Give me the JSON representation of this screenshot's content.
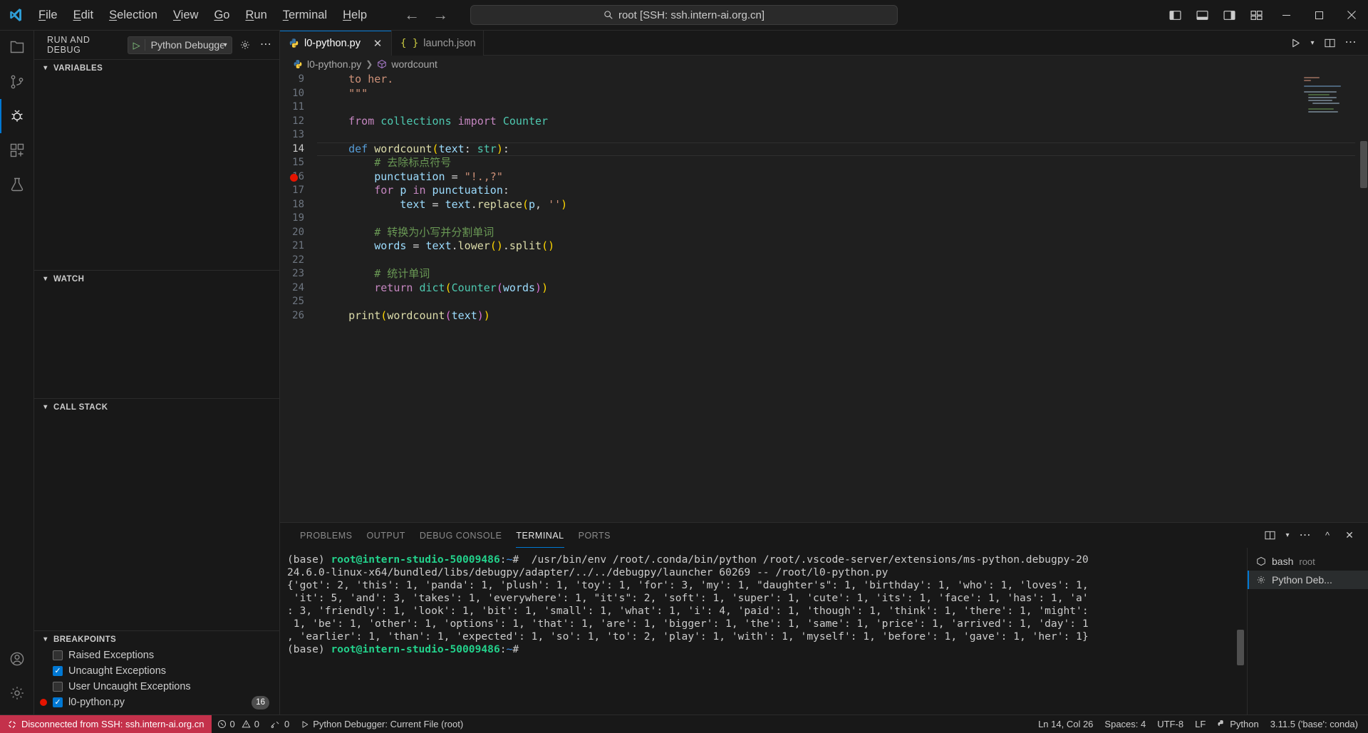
{
  "titlebar": {
    "logo_icon": "vscode-logo",
    "menu": [
      {
        "label": "File",
        "mnemonic": "F"
      },
      {
        "label": "Edit",
        "mnemonic": "E"
      },
      {
        "label": "Selection",
        "mnemonic": "S"
      },
      {
        "label": "View",
        "mnemonic": "V"
      },
      {
        "label": "Go",
        "mnemonic": "G"
      },
      {
        "label": "Run",
        "mnemonic": "R"
      },
      {
        "label": "Terminal",
        "mnemonic": "T"
      },
      {
        "label": "Help",
        "mnemonic": "H"
      }
    ],
    "back_icon": "arrow-left-icon",
    "forward_icon": "arrow-right-icon",
    "command_center": {
      "text": "root [SSH: ssh.intern-ai.org.cn]",
      "icon": "search-icon"
    },
    "layout_icons": [
      "toggle-primary-sidebar-icon",
      "toggle-panel-icon",
      "toggle-secondary-sidebar-icon",
      "customize-layout-icon"
    ],
    "window_controls": {
      "minimize": "─",
      "maximize": "☐",
      "close": "✕"
    }
  },
  "activitybar": {
    "items": [
      {
        "name": "explorer",
        "icon": "files-icon",
        "active": false
      },
      {
        "name": "source-control",
        "icon": "source-control-icon",
        "active": false
      },
      {
        "name": "run-and-debug",
        "icon": "debug-icon",
        "active": true
      },
      {
        "name": "extensions",
        "icon": "extensions-icon",
        "active": false
      },
      {
        "name": "testing",
        "icon": "beaker-icon",
        "active": false
      }
    ],
    "bottom": [
      {
        "name": "accounts",
        "icon": "account-icon"
      },
      {
        "name": "settings",
        "icon": "gear-icon"
      }
    ]
  },
  "sidebar": {
    "title": "RUN AND DEBUG",
    "debug_config": {
      "label": "Python Debugger: ",
      "play_icon": "play-icon",
      "chevron": "⌄"
    },
    "gear_icon": "gear-icon",
    "more_icon": "ellipsis-icon",
    "sections": [
      {
        "name": "variables",
        "title": "VARIABLES",
        "expanded": true
      },
      {
        "name": "watch",
        "title": "WATCH",
        "expanded": true
      },
      {
        "name": "call-stack",
        "title": "CALL STACK",
        "expanded": true
      },
      {
        "name": "breakpoints",
        "title": "BREAKPOINTS",
        "expanded": true
      }
    ],
    "breakpoints": [
      {
        "label": "Raised Exceptions",
        "checked": false,
        "dot": false,
        "badge": null
      },
      {
        "label": "Uncaught Exceptions",
        "checked": true,
        "dot": false,
        "badge": null
      },
      {
        "label": "User Uncaught Exceptions",
        "checked": false,
        "dot": false,
        "badge": null
      },
      {
        "label": "l0-python.py",
        "checked": true,
        "dot": true,
        "badge": "16"
      }
    ]
  },
  "editor": {
    "tabs": [
      {
        "label": "l0-python.py",
        "icon": "python-icon",
        "active": true,
        "close": "✕"
      },
      {
        "label": "launch.json",
        "icon": "json-braces-icon",
        "active": false,
        "close": ""
      }
    ],
    "actions": [
      "run-python-file-icon",
      "chevron-down-icon",
      "split-editor-icon",
      "more-actions-icon"
    ],
    "breadcrumb": {
      "file": "l0-python.py",
      "file_icon": "python-icon",
      "separator": "›",
      "symbol": "wordcount",
      "symbol_icon": "symbol-method-icon"
    },
    "first_line_number": 9,
    "current_line": 14,
    "breakpoint_line": 16,
    "lines": [
      {
        "n": 9,
        "tokens": [
          {
            "t": "    ",
            "c": "pl"
          },
          {
            "t": "to her.",
            "c": "str"
          }
        ]
      },
      {
        "n": 10,
        "tokens": [
          {
            "t": "    ",
            "c": "pl"
          },
          {
            "t": "\"\"\"",
            "c": "str"
          }
        ]
      },
      {
        "n": 11,
        "tokens": []
      },
      {
        "n": 12,
        "tokens": [
          {
            "t": "    ",
            "c": "pl"
          },
          {
            "t": "from",
            "c": "k"
          },
          {
            "t": " ",
            "c": "pl"
          },
          {
            "t": "collections",
            "c": "ty"
          },
          {
            "t": " ",
            "c": "pl"
          },
          {
            "t": "import",
            "c": "k"
          },
          {
            "t": " ",
            "c": "pl"
          },
          {
            "t": "Counter",
            "c": "ty"
          }
        ]
      },
      {
        "n": 13,
        "tokens": []
      },
      {
        "n": 14,
        "tokens": [
          {
            "t": "    ",
            "c": "pl"
          },
          {
            "t": "def",
            "c": "kw"
          },
          {
            "t": " ",
            "c": "pl"
          },
          {
            "t": "wordcount",
            "c": "fn"
          },
          {
            "t": "(",
            "c": "pun"
          },
          {
            "t": "text",
            "c": "var"
          },
          {
            "t": ": ",
            "c": "pl"
          },
          {
            "t": "str",
            "c": "ty"
          },
          {
            "t": ")",
            "c": "pun"
          },
          {
            "t": ":",
            "c": "pl"
          }
        ]
      },
      {
        "n": 15,
        "tokens": [
          {
            "t": "        ",
            "c": "pl"
          },
          {
            "t": "# 去除标点符号",
            "c": "cmt"
          }
        ]
      },
      {
        "n": 16,
        "tokens": [
          {
            "t": "        ",
            "c": "pl"
          },
          {
            "t": "punctuation",
            "c": "var"
          },
          {
            "t": " ",
            "c": "pl"
          },
          {
            "t": "=",
            "c": "pl"
          },
          {
            "t": " ",
            "c": "pl"
          },
          {
            "t": "\"!.,?\"",
            "c": "str"
          }
        ]
      },
      {
        "n": 17,
        "tokens": [
          {
            "t": "        ",
            "c": "pl"
          },
          {
            "t": "for",
            "c": "k"
          },
          {
            "t": " ",
            "c": "pl"
          },
          {
            "t": "p",
            "c": "var"
          },
          {
            "t": " ",
            "c": "pl"
          },
          {
            "t": "in",
            "c": "k"
          },
          {
            "t": " ",
            "c": "pl"
          },
          {
            "t": "punctuation",
            "c": "var"
          },
          {
            "t": ":",
            "c": "pl"
          }
        ]
      },
      {
        "n": 18,
        "tokens": [
          {
            "t": "            ",
            "c": "pl"
          },
          {
            "t": "text",
            "c": "var"
          },
          {
            "t": " = ",
            "c": "pl"
          },
          {
            "t": "text",
            "c": "var"
          },
          {
            "t": ".",
            "c": "pl"
          },
          {
            "t": "replace",
            "c": "fn"
          },
          {
            "t": "(",
            "c": "pun"
          },
          {
            "t": "p",
            "c": "var"
          },
          {
            "t": ", ",
            "c": "pl"
          },
          {
            "t": "''",
            "c": "str"
          },
          {
            "t": ")",
            "c": "pun"
          }
        ]
      },
      {
        "n": 19,
        "tokens": []
      },
      {
        "n": 20,
        "tokens": [
          {
            "t": "        ",
            "c": "pl"
          },
          {
            "t": "# 转换为小写并分割单词",
            "c": "cmt"
          }
        ]
      },
      {
        "n": 21,
        "tokens": [
          {
            "t": "        ",
            "c": "pl"
          },
          {
            "t": "words",
            "c": "var"
          },
          {
            "t": " = ",
            "c": "pl"
          },
          {
            "t": "text",
            "c": "var"
          },
          {
            "t": ".",
            "c": "pl"
          },
          {
            "t": "lower",
            "c": "fn"
          },
          {
            "t": "()",
            "c": "pun"
          },
          {
            "t": ".",
            "c": "pl"
          },
          {
            "t": "split",
            "c": "fn"
          },
          {
            "t": "()",
            "c": "pun"
          }
        ]
      },
      {
        "n": 22,
        "tokens": []
      },
      {
        "n": 23,
        "tokens": [
          {
            "t": "        ",
            "c": "pl"
          },
          {
            "t": "# 统计单词",
            "c": "cmt"
          }
        ]
      },
      {
        "n": 24,
        "tokens": [
          {
            "t": "        ",
            "c": "pl"
          },
          {
            "t": "return",
            "c": "k"
          },
          {
            "t": " ",
            "c": "pl"
          },
          {
            "t": "dict",
            "c": "ty"
          },
          {
            "t": "(",
            "c": "pun"
          },
          {
            "t": "Counter",
            "c": "ty"
          },
          {
            "t": "(",
            "c": "pun2"
          },
          {
            "t": "words",
            "c": "var"
          },
          {
            "t": ")",
            "c": "pun2"
          },
          {
            "t": ")",
            "c": "pun"
          }
        ]
      },
      {
        "n": 25,
        "tokens": []
      },
      {
        "n": 26,
        "tokens": [
          {
            "t": "    ",
            "c": "pl"
          },
          {
            "t": "print",
            "c": "fn"
          },
          {
            "t": "(",
            "c": "pun"
          },
          {
            "t": "wordcount",
            "c": "fn"
          },
          {
            "t": "(",
            "c": "pun2"
          },
          {
            "t": "text",
            "c": "var"
          },
          {
            "t": ")",
            "c": "pun2"
          },
          {
            "t": ")",
            "c": "pun"
          }
        ]
      }
    ]
  },
  "panel": {
    "tabs": [
      {
        "label": "PROBLEMS",
        "active": false
      },
      {
        "label": "OUTPUT",
        "active": false
      },
      {
        "label": "DEBUG CONSOLE",
        "active": false
      },
      {
        "label": "TERMINAL",
        "active": true
      },
      {
        "label": "PORTS",
        "active": false
      }
    ],
    "actions": [
      "split-terminal-icon",
      "chevron-down-icon",
      "more-actions-icon",
      "maximize-panel-icon",
      "close-panel-icon"
    ],
    "terminal_lines": [
      {
        "segments": [
          {
            "t": "(base) ",
            "c": "plain"
          },
          {
            "t": "root@intern-studio-50009486",
            "c": "green"
          },
          {
            "t": ":",
            "c": "plain"
          },
          {
            "t": "~",
            "c": "blue"
          },
          {
            "t": "#  /usr/bin/env /root/.conda/bin/python /root/.vscode-server/extensions/ms-python.debugpy-20",
            "c": "plain"
          }
        ]
      },
      {
        "segments": [
          {
            "t": "24.6.0-linux-x64/bundled/libs/debugpy/adapter/../../debugpy/launcher 60269 -- /root/l0-python.py",
            "c": "plain"
          }
        ]
      },
      {
        "segments": [
          {
            "t": "{'got': 2, 'this': 1, 'panda': 1, 'plush': 1, 'toy': 1, 'for': 3, 'my': 1, \"daughter's\": 1, 'birthday': 1, 'who': 1, 'loves': 1,",
            "c": "plain"
          }
        ]
      },
      {
        "segments": [
          {
            "t": " 'it': 5, 'and': 3, 'takes': 1, 'everywhere': 1, \"it's\": 2, 'soft': 1, 'super': 1, 'cute': 1, 'its': 1, 'face': 1, 'has': 1, 'a'",
            "c": "plain"
          }
        ]
      },
      {
        "segments": [
          {
            "t": ": 3, 'friendly': 1, 'look': 1, 'bit': 1, 'small': 1, 'what': 1, 'i': 4, 'paid': 1, 'though': 1, 'think': 1, 'there': 1, 'might':",
            "c": "plain"
          }
        ]
      },
      {
        "segments": [
          {
            "t": " 1, 'be': 1, 'other': 1, 'options': 1, 'that': 1, 'are': 1, 'bigger': 1, 'the': 1, 'same': 1, 'price': 1, 'arrived': 1, 'day': 1",
            "c": "plain"
          }
        ]
      },
      {
        "segments": [
          {
            "t": ", 'earlier': 1, 'than': 1, 'expected': 1, 'so': 1, 'to': 2, 'play': 1, 'with': 1, 'myself': 1, 'before': 1, 'gave': 1, 'her': 1}",
            "c": "plain"
          }
        ]
      },
      {
        "segments": [
          {
            "t": "(base) ",
            "c": "plain"
          },
          {
            "t": "root@intern-studio-50009486",
            "c": "green"
          },
          {
            "t": ":",
            "c": "plain"
          },
          {
            "t": "~",
            "c": "blue"
          },
          {
            "t": "#",
            "c": "plain"
          }
        ]
      }
    ],
    "terminal_list": [
      {
        "label": "bash",
        "sub": "root",
        "icon": "terminal-bash-icon",
        "active": false
      },
      {
        "label": "Python Deb...",
        "sub": "",
        "icon": "debug-gear-icon",
        "active": true
      }
    ]
  },
  "statusbar": {
    "remote": {
      "icon": "remote-disconnect-icon",
      "label": "Disconnected from SSH: ssh.intern-ai.org.cn"
    },
    "left": [
      {
        "name": "problems",
        "icon": "error-warning-icon",
        "label": "0  0",
        "errors": "0",
        "warnings": "0"
      },
      {
        "name": "ports",
        "icon": "ports-icon",
        "label": "0"
      },
      {
        "name": "debug-status",
        "icon": "play-icon",
        "label": "Python Debugger: Current File (root)"
      }
    ],
    "right": [
      {
        "name": "cursor-position",
        "label": "Ln 14, Col 26"
      },
      {
        "name": "indentation",
        "label": "Spaces: 4"
      },
      {
        "name": "encoding",
        "label": "UTF-8"
      },
      {
        "name": "eol",
        "label": "LF"
      },
      {
        "name": "language-mode",
        "label": "Python",
        "icon": "python-icon"
      },
      {
        "name": "python-interpreter",
        "label": "3.11.5 ('base': conda)"
      }
    ]
  },
  "colors": {
    "accent": "#0078d4",
    "remote_bg": "#c4314b",
    "breakpoint": "#e51400",
    "terminal_green": "#23d18b",
    "editor_bg": "#1f1f1f",
    "chrome_bg": "#181818"
  }
}
